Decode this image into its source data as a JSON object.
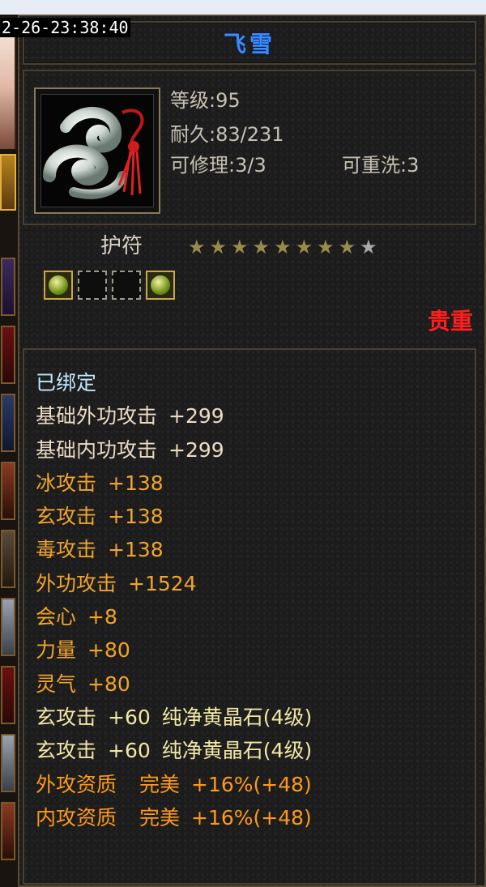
{
  "timestamp": "2-26-23:38:40",
  "item": {
    "name": "飞雪",
    "icon": "jade-cloud-amulet-icon",
    "level_label": "等级:95",
    "durability_label": "耐久:83/231",
    "repairable_label": "可修理:3/3",
    "rewash_label": "可重洗:3",
    "type": "护符",
    "stars_filled": 8,
    "stars_total": 9,
    "sockets": [
      "gem",
      "empty",
      "empty",
      "gem"
    ],
    "rarity": "贵重"
  },
  "properties": [
    {
      "label": "已绑定",
      "value": "",
      "extra": "",
      "color": "bound"
    },
    {
      "label": "基础外功攻击",
      "value": "+299",
      "extra": "",
      "color": "white"
    },
    {
      "label": "基础内功攻击",
      "value": "+299",
      "extra": "",
      "color": "white"
    },
    {
      "label": "冰攻击",
      "value": "+138",
      "extra": "",
      "color": "orange"
    },
    {
      "label": "玄攻击",
      "value": "+138",
      "extra": "",
      "color": "orange"
    },
    {
      "label": "毒攻击",
      "value": "+138",
      "extra": "",
      "color": "orange"
    },
    {
      "label": "外功攻击",
      "value": "+1524",
      "extra": "",
      "color": "orange"
    },
    {
      "label": "会心",
      "value": "+8",
      "extra": "",
      "color": "orange"
    },
    {
      "label": "力量",
      "value": "+80",
      "extra": "",
      "color": "orange"
    },
    {
      "label": "灵气",
      "value": "+80",
      "extra": "",
      "color": "orange"
    },
    {
      "label": "玄攻击",
      "value": "+60",
      "extra": "纯净黄晶石(4级)",
      "color": "yellow"
    },
    {
      "label": "玄攻击",
      "value": "+60",
      "extra": "纯净黄晶石(4级)",
      "color": "yellow"
    },
    {
      "label": "外攻资质",
      "value": "完美",
      "extra": "+16%(+48)",
      "color": "amber"
    },
    {
      "label": "内攻资质",
      "value": "完美",
      "extra": "+16%(+48)",
      "color": "amber"
    }
  ],
  "colors": {
    "title": "#3a8cff",
    "rarity": "#ff1e1e",
    "bound": "#bfe8ff",
    "white": "#eadbc4",
    "orange": "#f2a42c",
    "yellow": "#f2e8a4",
    "amber": "#ff9a18"
  }
}
